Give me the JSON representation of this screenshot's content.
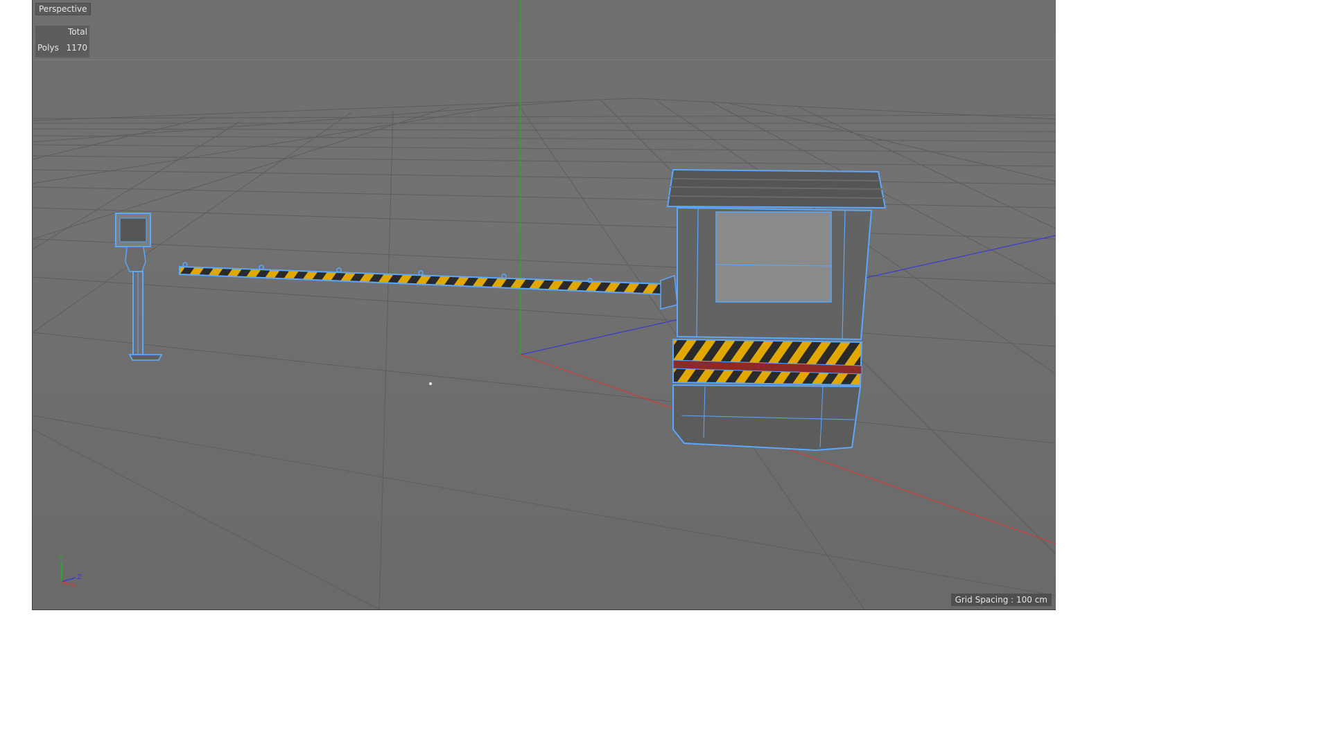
{
  "viewport": {
    "title": "Perspective",
    "stats": {
      "header": "Total",
      "label": "Polys",
      "value": "1170"
    },
    "grid_spacing": "Grid Spacing : 100 cm"
  },
  "gizmo": {
    "y_label": "Y",
    "z_label": "Z",
    "x_label": "X"
  },
  "colors": {
    "background": "#6f6f6f",
    "grid_line": "#5e5e5e",
    "y_axis": "#1fb21f",
    "x_axis": "#d33a3a",
    "z_axis": "#3a3ad3",
    "wireframe": "#5aa8ff",
    "stripe_yellow": "#e0a800",
    "stripe_dark": "#2a2a2a"
  },
  "scene_objects": [
    "parking-barrier-booth",
    "barrier-arm",
    "ticket-post"
  ]
}
